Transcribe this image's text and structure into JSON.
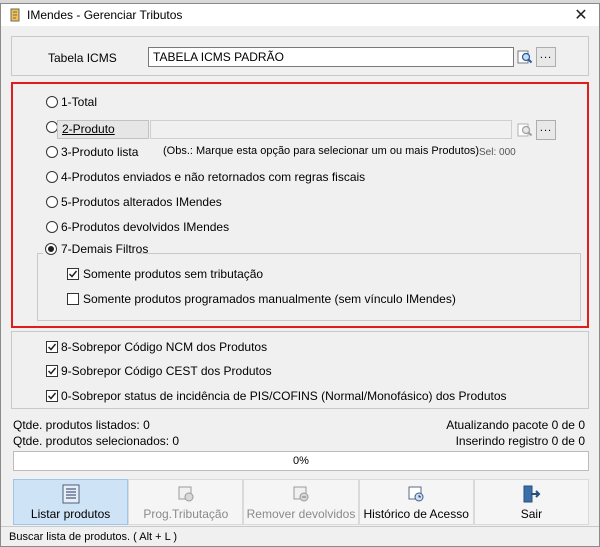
{
  "window": {
    "title": "IMendes - Gerenciar Tributos",
    "close_label": "✕"
  },
  "icms": {
    "label": "Tabela ICMS",
    "value": "TABELA ICMS PADRÃO",
    "dots": "..."
  },
  "options": {
    "total": "1-Total",
    "produto": "2-Produto",
    "produto_value": "",
    "dots": "...",
    "produto_lista": "3-Produto lista",
    "obs": "(Obs.: Marque esta opção para selecionar um ou mais Produtos)",
    "sel": "Sel: 000",
    "enviados": "4-Produtos enviados e não retornados com regras fiscais",
    "alterados": "5-Produtos alterados IMendes",
    "devolvidos": "6-Produtos devolvidos IMendes",
    "demais": "7-Demais Filtros",
    "selected": "7-Demais Filtros"
  },
  "filters": {
    "sem_tributacao": "Somente produtos sem tributação",
    "sem_tributacao_checked": true,
    "programados": "Somente produtos programados manualmente (sem vínculo IMendes)",
    "programados_checked": false
  },
  "overrides": {
    "ncm": "8-Sobrepor Código NCM dos Produtos",
    "cest": "9-Sobrepor Código CEST dos Produtos",
    "pis": "0-Sobrepor status de incidência de PIS/COFINS (Normal/Monofásico) dos Produtos"
  },
  "stats": {
    "listados": "Qtde. produtos listados: 0",
    "selecionados": "Qtde. produtos selecionados: 0",
    "pacote": "Atualizando pacote 0 de 0",
    "registro": "Inserindo registro 0 de 0"
  },
  "progress": {
    "text": "0%",
    "value": 0
  },
  "toolbar": {
    "listar": "Listar produtos",
    "prog": "Prog.Tributação",
    "remover": "Remover devolvidos",
    "historico": "Histórico de Acesso",
    "sair": "Sair"
  },
  "status": {
    "text": "Buscar lista de produtos. ( Alt + L )"
  },
  "colors": {
    "highlight_border": "#e01c1c",
    "active_button": "#cfe3f7"
  }
}
